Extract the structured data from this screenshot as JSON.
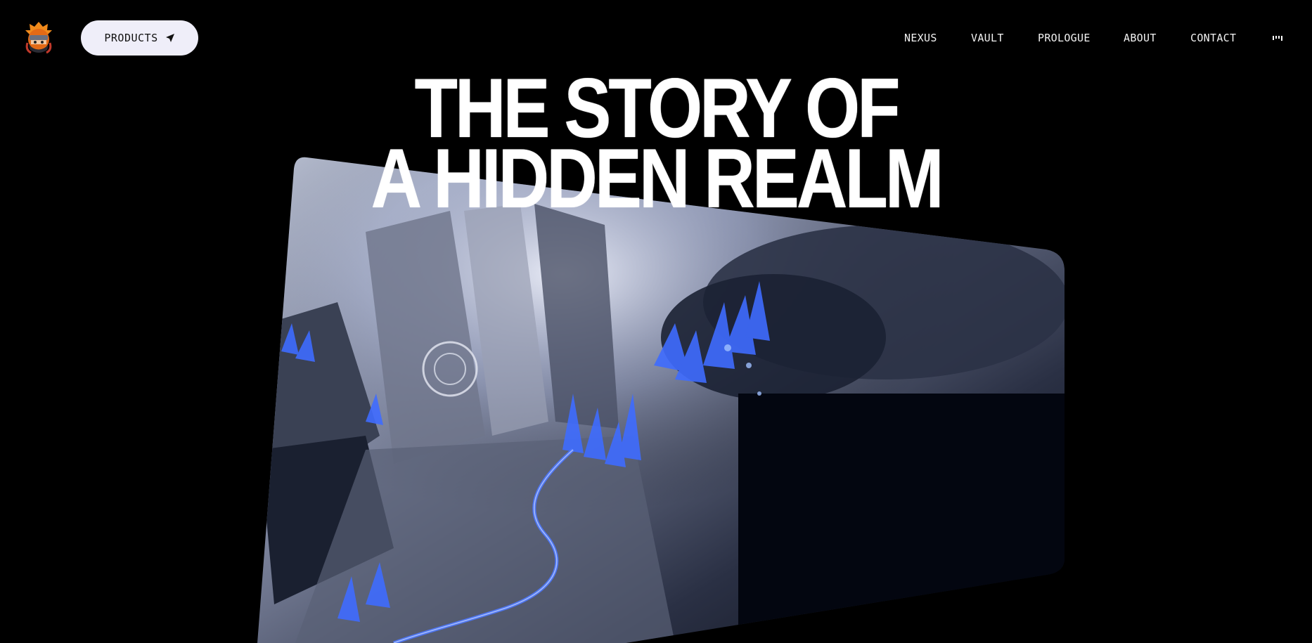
{
  "header": {
    "logo_icon": "ninja-mascot-logo-icon",
    "products_button": {
      "label": "PRODUCTS",
      "icon": "send-arrow-icon"
    },
    "nav": [
      {
        "label": "NEXUS"
      },
      {
        "label": "VAULT"
      },
      {
        "label": "PROLOGUE"
      },
      {
        "label": "ABOUT"
      },
      {
        "label": "CONTACT"
      }
    ],
    "audio_icon": "audio-bars-icon"
  },
  "hero": {
    "title_line1": "THE STORY OF",
    "title_line2": "A HIDDEN REALM",
    "image_description_icon": "crystal-cave-scene-image"
  },
  "colors": {
    "background": "#000000",
    "button_bg": "#efeef9",
    "text": "#ffffff",
    "crystal_blue": "#3f6cff"
  }
}
